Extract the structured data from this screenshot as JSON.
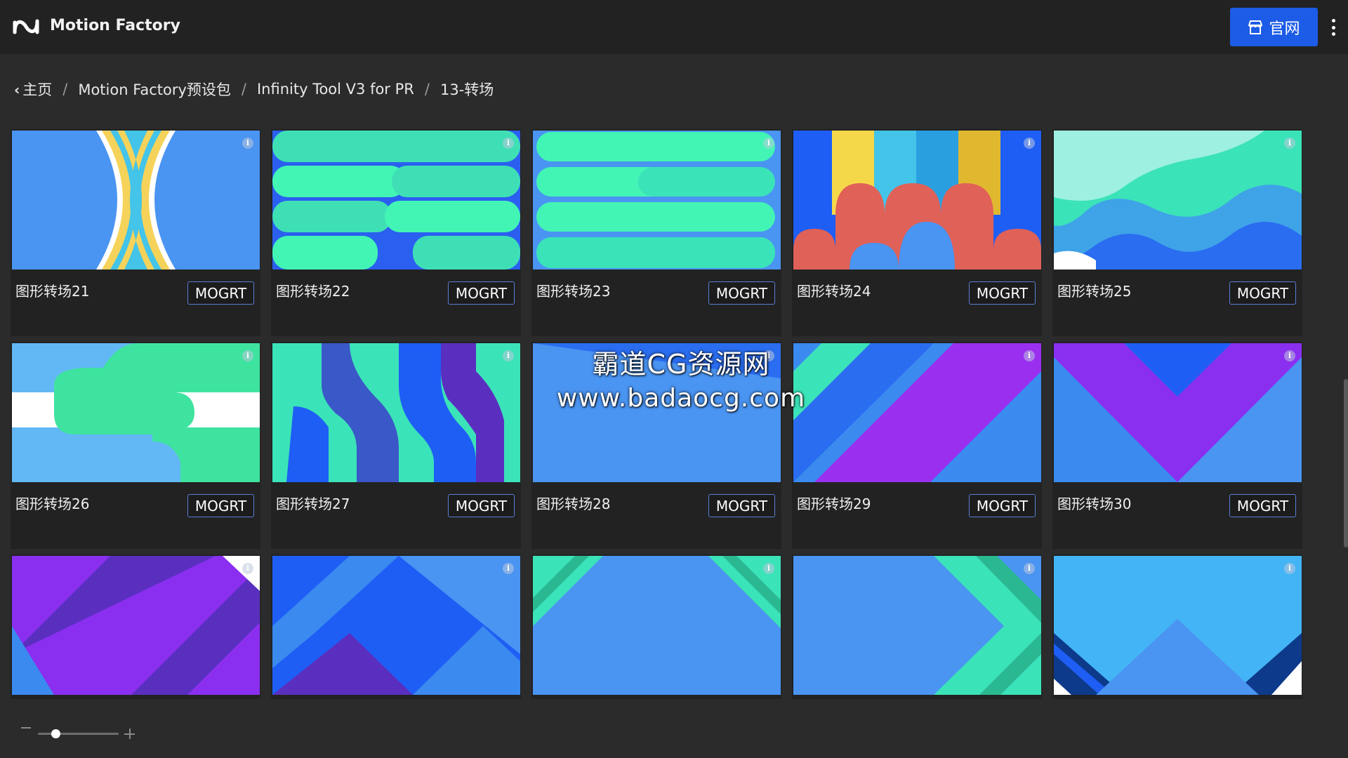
{
  "header": {
    "app_title": "Motion Factory",
    "site_button_label": "官网"
  },
  "breadcrumb": [
    "主页",
    "Motion Factory预设包",
    "Infinity Tool V3 for PR",
    "13-转场"
  ],
  "breadcrumb_separator": "/",
  "grid": {
    "badge_label": "MOGRT",
    "info_glyph": "i",
    "items": [
      {
        "title": "图形转场21",
        "colors": [
          "#4a94f2",
          "#f5d35a",
          "#43c4e8"
        ]
      },
      {
        "title": "图形转场22",
        "colors": [
          "#3fdfb6",
          "#42f5b5",
          "#2a5ff0"
        ]
      },
      {
        "title": "图形转场23",
        "colors": [
          "#4a94f2",
          "#3be3b8",
          "#42f5b5"
        ]
      },
      {
        "title": "图形转场24",
        "colors": [
          "#1e5ef5",
          "#f5d84a",
          "#e06158",
          "#4a94f2"
        ]
      },
      {
        "title": "图形转场25",
        "colors": [
          "#2a6df0",
          "#3fa3e8",
          "#3be3b8",
          "#9ef0e0"
        ]
      },
      {
        "title": "图形转场26",
        "colors": [
          "#3fe3a0",
          "#62b8f5",
          "#ffffff"
        ]
      },
      {
        "title": "图形转场27",
        "colors": [
          "#3be3b8",
          "#3a58c8",
          "#1e5ef5",
          "#5a2fc0"
        ]
      },
      {
        "title": "图形转场28",
        "colors": [
          "#4a94f2",
          "#2a6df0"
        ]
      },
      {
        "title": "图形转场29",
        "colors": [
          "#2a6df0",
          "#9a2ff0",
          "#3be3b8"
        ]
      },
      {
        "title": "图形转场30",
        "colors": [
          "#4a94f2",
          "#8a2ff0",
          "#1e5ef5"
        ]
      },
      {
        "title": "",
        "colors": [
          "#8a2ff0",
          "#5a2fc0",
          "#3a8af0"
        ]
      },
      {
        "title": "",
        "colors": [
          "#1e5ef5",
          "#5a2fc0",
          "#4a94f2"
        ]
      },
      {
        "title": "",
        "colors": [
          "#4a94f2",
          "#3be3b8"
        ]
      },
      {
        "title": "",
        "colors": [
          "#4a94f2",
          "#3be3b8"
        ]
      },
      {
        "title": "",
        "colors": [
          "#43b4f5",
          "#0d3a8a",
          "#4a94f2"
        ]
      }
    ]
  },
  "watermark": {
    "line1": "霸道CG资源网",
    "line2": "www.badaocg.com"
  },
  "zoom": {
    "level_fraction": 0.2
  },
  "colors": {
    "accent": "#1c5ce6",
    "background": "#2b2b2b",
    "card": "#222222"
  },
  "icons": [
    "motion-factory-logo-icon",
    "store-icon",
    "more-vertical-icon",
    "chevron-left-icon",
    "info-icon",
    "zoom-out-icon",
    "zoom-in-icon"
  ]
}
